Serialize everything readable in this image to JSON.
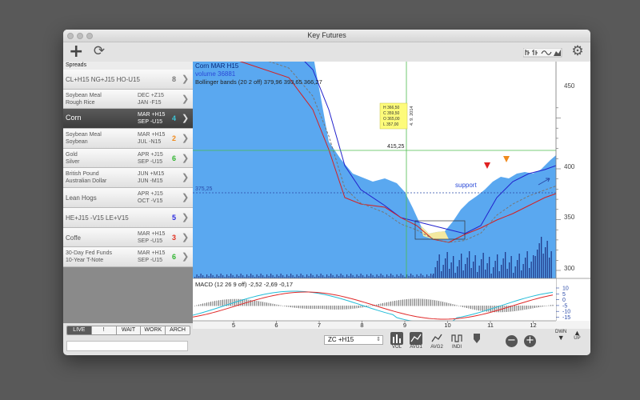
{
  "window": {
    "title": "Key Futures"
  },
  "toolbar": {
    "add_icon": "+",
    "refresh_icon": "⟳",
    "settings_icon": "⚙"
  },
  "sidebar": {
    "header": "Spreads",
    "rows": [
      {
        "left1": "CL+H15 NG+J15 HO-U15",
        "left2": "",
        "right1": "",
        "right2": "",
        "num": "8",
        "num_color": "#777777"
      },
      {
        "left1": "Soybean Meal",
        "left2": "Rough Rice",
        "right1": "DEC +Z15",
        "right2": "JAN -F15",
        "num": "",
        "num_color": "#777777"
      },
      {
        "left1": "Corn",
        "left2": "",
        "right1": "MAR +H15",
        "right2": "SEP -U15",
        "num": "4",
        "num_color": "#3cc6d8"
      },
      {
        "left1": "Soybean Meal",
        "left2": "Soybean",
        "right1": "MAR +H15",
        "right2": "JUL -N15",
        "num": "2",
        "num_color": "#f08a1c"
      },
      {
        "left1": "Gold",
        "left2": "Silver",
        "right1": "APR +J15",
        "right2": "SEP -U15",
        "num": "6",
        "num_color": "#2fb52f"
      },
      {
        "left1": "British Pound",
        "left2": "Australian Dollar",
        "right1": "JUN +M15",
        "right2": "JUN -M15",
        "num": "",
        "num_color": "#777777"
      },
      {
        "left1": "Lean Hogs",
        "left2": "",
        "right1": "APR +J15",
        "right2": "OCT -V15",
        "num": "",
        "num_color": "#777777"
      },
      {
        "left1": "HE+J15 -V15 LE+V15",
        "left2": "",
        "right1": "",
        "right2": "",
        "num": "5",
        "num_color": "#2a2ae0"
      },
      {
        "left1": "Coffe",
        "left2": "",
        "right1": "MAR +H15",
        "right2": "SEP -U15",
        "num": "3",
        "num_color": "#e03020"
      },
      {
        "left1": "30-Day Fed Funds",
        "left2": "10-Year T-Note",
        "right1": "MAR +H15",
        "right2": "SEP -U15",
        "num": "6",
        "num_color": "#2fb52f"
      }
    ],
    "tabs": [
      "LIVE",
      "!",
      "WAIT",
      "WORK",
      "ARCH"
    ],
    "search_value": ""
  },
  "chart": {
    "title": "Corn MAR H15",
    "volume": "volume 36881",
    "bollinger": "Bollinger bands (20  2  off)   379,96  393,65  366,27",
    "crosshair_date": "4. 9. 2014",
    "ohlc": [
      "H 366,50",
      "C 359,50",
      "O 365,00",
      "L 357,00"
    ],
    "price_line_1": "415,25",
    "price_line_2": "375,25",
    "support_label": "support",
    "price_ticks": [
      "450",
      "400",
      "350",
      "300"
    ],
    "macd": "MACD (12  26  9  off)   -2,52  -2,69  -0,17",
    "macd_ticks": [
      "10",
      "5",
      "0",
      "-5",
      "-10",
      "-15",
      "-20",
      "-25"
    ],
    "x_ticks": [
      "5",
      "6",
      "7",
      "8",
      "9",
      "10",
      "11",
      "12"
    ],
    "colors": {
      "price_fill": "#5aa8f0",
      "upper_band": "#2222cc",
      "lower_band": "#d62020",
      "mid_band": "#777777",
      "macd_cyan": "#22bcd8",
      "macd_red": "#e02828",
      "green_line": "#4dbb4d"
    }
  },
  "bottom": {
    "symbol": "ZC +H15",
    "buttons": [
      "VOL",
      "AVG1",
      "AVG2",
      "INDI",
      ""
    ],
    "dwn": "DWN",
    "up": "UP"
  }
}
